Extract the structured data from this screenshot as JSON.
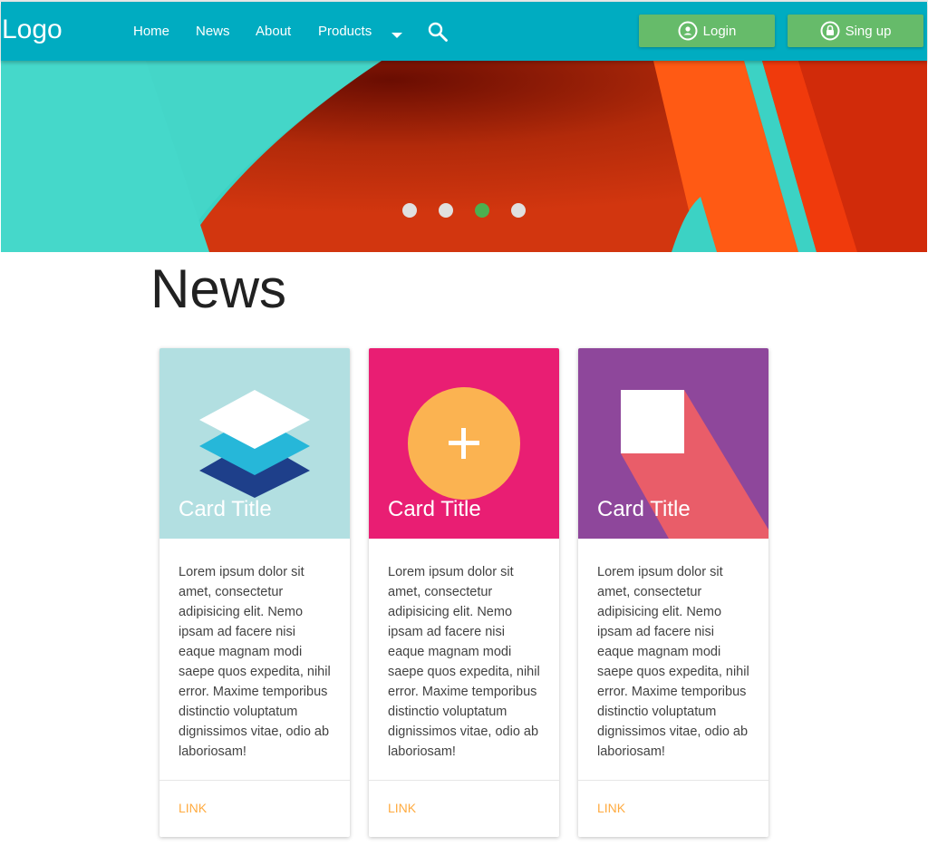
{
  "navbar": {
    "logo": "Logo",
    "links": [
      "Home",
      "News",
      "About",
      "Products"
    ],
    "login_label": "Login",
    "signup_label": "Sing up",
    "bg_color": "#00acc1",
    "button_color": "#66bb6a"
  },
  "carousel": {
    "slide_count": 4,
    "active_index": 2
  },
  "news": {
    "title": "News",
    "cards": [
      {
        "title": "Card Title",
        "image_icon": "layers-icon",
        "image_bg": "#b2dfe1",
        "body": "Lorem ipsum dolor sit amet, consectetur adipisicing elit. Nemo ipsam ad facere nisi eaque magnam modi saepe quos expedita, nihil error. Maxime temporibus distinctio voluptatum dignissimos vitae, odio ab laboriosam!",
        "link": "LINK"
      },
      {
        "title": "Card Title",
        "image_icon": "plus-circle-icon",
        "image_bg": "#e91e73",
        "body": "Lorem ipsum dolor sit amet, consectetur adipisicing elit. Nemo ipsam ad facere nisi eaque magnam modi saepe quos expedita, nihil error. Maxime temporibus distinctio voluptatum dignissimos vitae, odio ab laboriosam!",
        "link": "LINK"
      },
      {
        "title": "Card Title",
        "image_icon": "square-shadow-icon",
        "image_bg": "#8e479b",
        "body": "Lorem ipsum dolor sit amet, consectetur adipisicing elit. Nemo ipsam ad facere nisi eaque magnam modi saepe quos expedita, nihil error. Maxime temporibus distinctio voluptatum dignissimos vitae, odio ab laboriosam!",
        "link": "LINK"
      }
    ],
    "link_color": "#ffab40"
  }
}
